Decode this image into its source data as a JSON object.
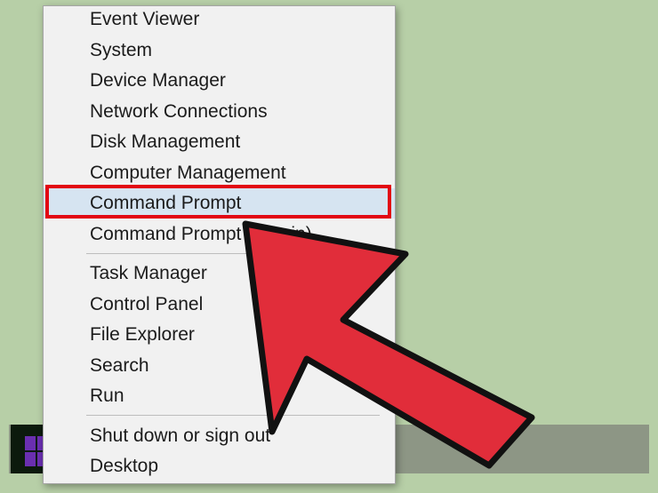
{
  "colors": {
    "background": "#b7cfa7",
    "menu_background": "#f1f1f1",
    "selected_background": "#d6e4f1",
    "highlight_border": "#e20613",
    "arrow_fill": "#e12d3a",
    "arrow_outline": "#111111",
    "start_logo": "#6a2fb0"
  },
  "taskbar": {
    "start_button_icon": "windows-logo-icon"
  },
  "menu": {
    "items": [
      {
        "label": "Event Viewer"
      },
      {
        "label": "System"
      },
      {
        "label": "Device Manager"
      },
      {
        "label": "Network Connections"
      },
      {
        "label": "Disk Management"
      },
      {
        "label": "Computer Management"
      },
      {
        "label": "Command Prompt",
        "selected": true
      },
      {
        "label": "Command Prompt (Admin)"
      },
      {
        "label": "Task Manager"
      },
      {
        "label": "Control Panel"
      },
      {
        "label": "File Explorer"
      },
      {
        "label": "Search"
      },
      {
        "label": "Run"
      },
      {
        "label": "Shut down or sign out"
      },
      {
        "label": "Desktop"
      }
    ]
  },
  "annotation": {
    "arrow_icon": "pointer-arrow-icon",
    "highlight": "red-outline-box"
  }
}
